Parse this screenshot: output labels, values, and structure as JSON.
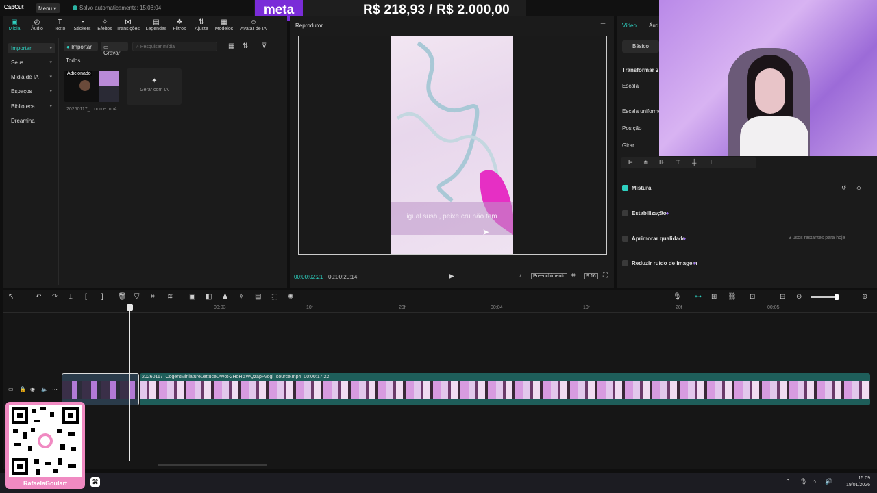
{
  "app": {
    "logo": "CapCut",
    "menu_label": "Menu",
    "save_status": "Salvo automaticamente: 15:08:04"
  },
  "overlay": {
    "brand": "meta",
    "amount": "R$ 218,93 / R$ 2.000,00",
    "streamer": "RafaelaGoulart"
  },
  "toolbar": {
    "tabs": [
      {
        "label": "Mídia",
        "icon": "media-icon"
      },
      {
        "label": "Áudio",
        "icon": "audio-icon"
      },
      {
        "label": "Texto",
        "icon": "text-icon"
      },
      {
        "label": "Stickers",
        "icon": "sticker-icon"
      },
      {
        "label": "Efeitos",
        "icon": "effects-icon"
      },
      {
        "label": "Transições",
        "icon": "transitions-icon"
      },
      {
        "label": "Legendas",
        "icon": "captions-icon"
      },
      {
        "label": "Filtros",
        "icon": "filters-icon"
      },
      {
        "label": "Ajuste",
        "icon": "adjust-icon"
      },
      {
        "label": "Modelos",
        "icon": "templates-icon"
      },
      {
        "label": "Avatar de IA",
        "icon": "avatar-icon"
      }
    ]
  },
  "sidebar": {
    "items": [
      {
        "label": "Importar"
      },
      {
        "label": "Seus"
      },
      {
        "label": "Mídia de IA"
      },
      {
        "label": "Espaços"
      },
      {
        "label": "Biblioteca"
      },
      {
        "label": "Dreamina"
      }
    ]
  },
  "media": {
    "import_label": "Importar",
    "record_label": "Gravar",
    "search_placeholder": "Pesquisar mídia",
    "all_label": "Todos",
    "added_badge": "Adicionado",
    "clip_caption": "20260117_...ource.mp4",
    "generate_label": "Gerar com IA"
  },
  "player": {
    "title": "Reprodutor",
    "subtitle_text": "igual sushi, peixe cru não tem",
    "current_time": "00:00:02:21",
    "total_time": "00:00:20:14",
    "fill_label": "Preenchimento",
    "ratio_label": "9:16"
  },
  "props": {
    "tab_video": "Vídeo",
    "tab_audio": "Áud",
    "basic_tab": "Básico",
    "transform_label": "Transformar 2",
    "scale_label": "Escala",
    "uniform_scale_label": "Escala uniforme",
    "position_label": "Posição",
    "rotate_label": "Girar",
    "blend_label": "Mistura",
    "stabilize_label": "Estabilização",
    "enhance_label": "Aprimorar qualidade",
    "uses_left": "3 usos restantes para hoje",
    "denoise_label": "Reduzir ruído de imagem"
  },
  "timeline": {
    "ruler": [
      "00:03",
      "10f",
      "20f",
      "00:04",
      "10f",
      "20f",
      "00:05"
    ],
    "clip_title": "20260117_CogentMiniatureLettuceUWot-2HoHizWQzapFvogl_source.mp4",
    "clip_duration": "00:00:17:22"
  },
  "taskbar": {
    "time": "15:09",
    "date": "19/01/2026"
  }
}
